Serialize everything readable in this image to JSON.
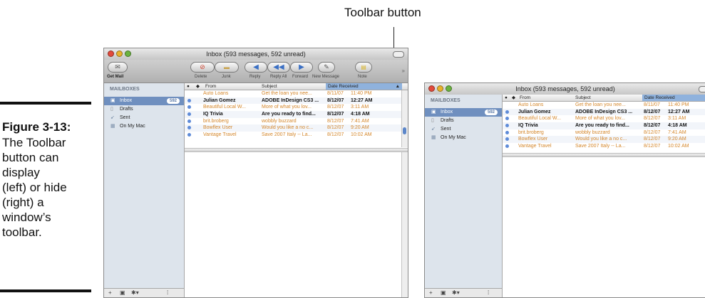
{
  "callout": {
    "label": "Toolbar button"
  },
  "figure": {
    "number": "Figure 3-13:",
    "caption_lines": [
      "The Toolbar",
      "button can",
      "display",
      "(left) or hide",
      "(right) a",
      "window’s",
      "toolbar."
    ]
  },
  "window": {
    "title": "Inbox (593 messages, 592 unread)",
    "toolbar": {
      "get_mail": "Get Mail",
      "delete": "Delete",
      "junk": "Junk",
      "reply": "Reply",
      "reply_all": "Reply All",
      "forward": "Forward",
      "new_message": "New Message",
      "note": "Note"
    },
    "sidebar": {
      "header": "MAILBOXES",
      "items": [
        {
          "label": "Inbox",
          "badge": "592",
          "icon": "inbox-icon"
        },
        {
          "label": "Drafts",
          "icon": "drafts-icon"
        },
        {
          "label": "Sent",
          "icon": "sent-icon"
        },
        {
          "label": "On My Mac",
          "icon": "on-my-mac-icon"
        }
      ],
      "bottom_buttons": [
        "+",
        "▣",
        "✱▾",
        "⁞"
      ]
    },
    "columns": {
      "from": "From",
      "subject": "Subject",
      "date": "Date Received"
    },
    "messages": [
      {
        "from": "Auto Loans",
        "subject": "Get the loan you nee...",
        "date": "8/11/07",
        "time": "11:40 PM",
        "unread": false
      },
      {
        "from": "Julian Gomez",
        "subject": "ADOBE InDesign CS3 ...",
        "date": "8/12/07",
        "time": "12:27 AM",
        "unread": true
      },
      {
        "from": "Beautiful Local W...",
        "subject": "More of what you lov...",
        "date": "8/12/07",
        "time": "3:11 AM",
        "unread": false
      },
      {
        "from": "IQ Trivia",
        "subject": "Are you ready to find...",
        "date": "8/12/07",
        "time": "4:18 AM",
        "unread": true
      },
      {
        "from": "brit.broberg",
        "subject": "wobbly buzzard",
        "date": "8/12/07",
        "time": "7:41 AM",
        "unread": false
      },
      {
        "from": "Bowflex User",
        "subject": "Would you like a no c...",
        "date": "8/12/07",
        "time": "9:20 AM",
        "unread": false
      },
      {
        "from": "Vantage Travel",
        "subject": "Save 2007 Italy -- La...",
        "date": "8/12/07",
        "time": "10:02 AM",
        "unread": false
      }
    ],
    "right_window_subject_overrides": [
      "Get the loan you nee...",
      "ADOBE InDesign CS3 ...",
      "More of what you lov...",
      "Are you ready to find...",
      "wobbly buzzard",
      "Would you like a no c...",
      "Save 2007 Italy -- La..."
    ],
    "colors": {
      "unread_dot": "#5e8bd8",
      "read_text": "#d4862a",
      "selection": "#6f8fbf"
    }
  }
}
